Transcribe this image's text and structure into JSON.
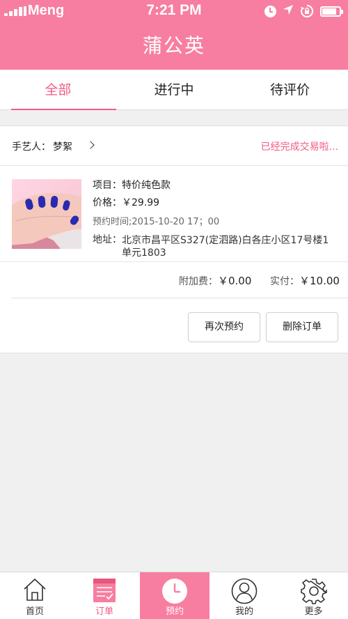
{
  "status_bar": {
    "carrier": "Meng",
    "time": "7:21 PM",
    "battery_percent": 85
  },
  "nav": {
    "title": "蒲公英"
  },
  "tabs": [
    {
      "label": "全部",
      "active": true
    },
    {
      "label": "进行中",
      "active": false
    },
    {
      "label": "待评价",
      "active": false
    }
  ],
  "order": {
    "artisan_label": "手艺人：",
    "artisan_name": "梦絮",
    "status": "已经完成交易啦...",
    "project": "项目：特价纯色款",
    "price": "价格：￥29.99",
    "appointment_time": "预约时间;2015-10-20 17；00",
    "address_label": "地址：",
    "address": "北京市昌平区S327(定泗路)白各庄小区17号楼1单元1803",
    "extra_fee_label": "附加费：",
    "extra_fee": "￥0.00",
    "paid_label": "实付：",
    "paid": "￥10.00",
    "rebook_button": "再次预约",
    "delete_button": "删除订单"
  },
  "tab_bar": {
    "items": [
      {
        "label": "首页",
        "icon": "home-icon"
      },
      {
        "label": "订单",
        "icon": "orders-icon"
      },
      {
        "label": "预约",
        "icon": "clock-icon"
      },
      {
        "label": "我的",
        "icon": "profile-icon"
      },
      {
        "label": "更多",
        "icon": "gear-icon"
      }
    ]
  },
  "colors": {
    "brand_pink": "#f77ea0",
    "accent_pink": "#f25b85",
    "nail_polish": "#2a2bb0"
  }
}
